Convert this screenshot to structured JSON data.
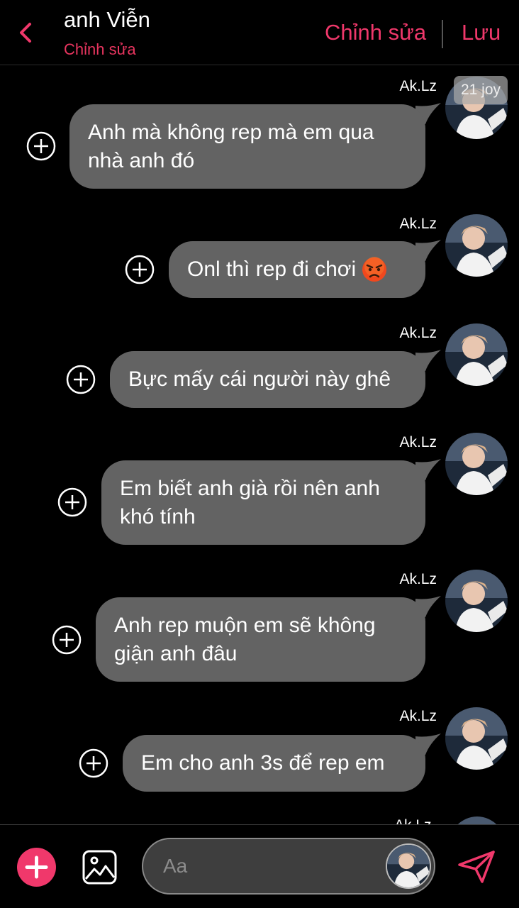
{
  "header": {
    "title": "anh Viễn",
    "subtitle": "Chỉnh sửa",
    "edit_label": "Chỉnh sửa",
    "save_label": "Lưu"
  },
  "badge": "21 joy",
  "messages": [
    {
      "sender": "Ak.Lz",
      "line1": "Anh mà không rep mà em qua",
      "line2": "nhà anh đó"
    },
    {
      "sender": "Ak.Lz",
      "line1": "Onl thì rep đi chơi",
      "emoji": "angry-face-emoji"
    },
    {
      "sender": "Ak.Lz",
      "line1": "Bực mấy cái người này ghê"
    },
    {
      "sender": "Ak.Lz",
      "line1": "Em biết anh già rồi nên anh",
      "line2": "khó tính"
    },
    {
      "sender": "Ak.Lz",
      "line1": "Anh rep muộn em sẽ không",
      "line2": "giận anh đâu"
    },
    {
      "sender": "Ak.Lz",
      "line1": "Em cho anh 3s để rep em"
    },
    {
      "sender": "Ak.Lz"
    }
  ],
  "composer": {
    "placeholder": "Aa"
  },
  "icons": {
    "back": "chevron-left-icon",
    "add": "plus-icon",
    "image": "image-icon",
    "send": "send-icon",
    "add_reaction": "plus-circle-icon"
  },
  "colors": {
    "accent": "#f0386b",
    "bubble": "#636363",
    "background": "#000000"
  }
}
